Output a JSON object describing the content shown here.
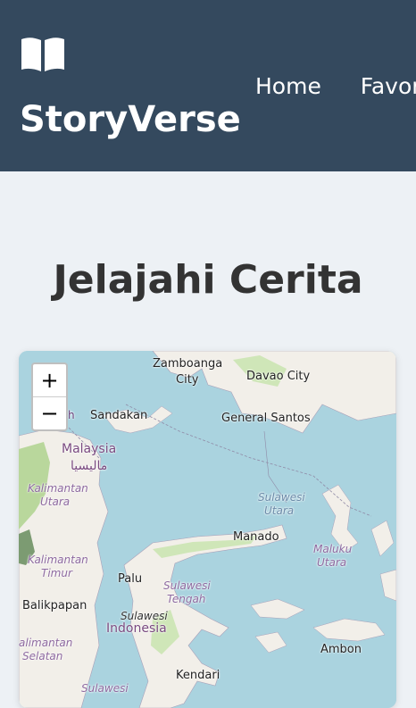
{
  "header": {
    "brand": "StoryVerse",
    "logo_icon": "open-book-icon",
    "nav": [
      {
        "label": "Home"
      },
      {
        "label": "Favori"
      }
    ]
  },
  "main": {
    "title": "Jelajahi Cerita"
  },
  "map": {
    "zoom_in": "+",
    "zoom_out": "−",
    "labels": {
      "zamboanga": "Zamboanga",
      "zamboanga2": "City",
      "davao": "Davao City",
      "sandakan": "Sandakan",
      "general_santos": "General Santos",
      "malaysia": "Malaysia",
      "malaysia_local": "ماليسيا",
      "kalimantan_utara": "Kalimantan",
      "kalimantan_utara2": "Utara",
      "sulawesi_utara": "Sulawesi",
      "sulawesi_utara2": "Utara",
      "manado": "Manado",
      "maluku_utara": "Maluku",
      "maluku_utara2": "Utara",
      "kalimantan_timur": "Kalimantan",
      "kalimantan_timur2": "Timur",
      "palu": "Palu",
      "sulawesi_tengah": "Sulawesi",
      "sulawesi_tengah2": "Tengah",
      "balikpapan": "Balikpapan",
      "sulawesi": "Sulawesi",
      "indonesia": "Indonesia",
      "kalimantan_selatan": "alimantan",
      "kalimantan_selatan2": "Selatan",
      "ambon": "Ambon",
      "kendari": "Kendari",
      "sulawesi_bottom": "Sulawesi",
      "sabah_frag": "h"
    }
  }
}
